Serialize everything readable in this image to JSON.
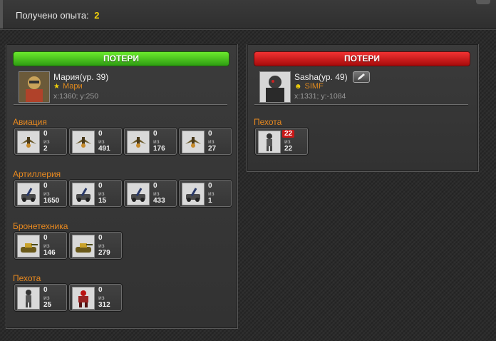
{
  "experience": {
    "label": "Получено опыта:",
    "value": "2"
  },
  "left": {
    "header": "ПОТЕРИ",
    "player": {
      "name": "Мария(ур. 39)",
      "clan": "Мари",
      "coords": "x:1360; y:250"
    },
    "categories": [
      {
        "title": "Авиация",
        "units": [
          {
            "lost": "0",
            "of": "из",
            "total": "2",
            "icon": "aircraft-icon"
          },
          {
            "lost": "0",
            "of": "из",
            "total": "491",
            "icon": "aircraft-icon"
          },
          {
            "lost": "0",
            "of": "из",
            "total": "176",
            "icon": "aircraft-icon"
          },
          {
            "lost": "0",
            "of": "из",
            "total": "27",
            "icon": "aircraft-icon"
          }
        ]
      },
      {
        "title": "Артиллерия",
        "units": [
          {
            "lost": "0",
            "of": "из",
            "total": "1650",
            "icon": "artillery-icon"
          },
          {
            "lost": "0",
            "of": "из",
            "total": "15",
            "icon": "artillery-icon"
          },
          {
            "lost": "0",
            "of": "из",
            "total": "433",
            "icon": "artillery-icon"
          },
          {
            "lost": "0",
            "of": "из",
            "total": "1",
            "icon": "artillery-icon"
          }
        ]
      },
      {
        "title": "Бронетехника",
        "units": [
          {
            "lost": "0",
            "of": "из",
            "total": "146",
            "icon": "tank-icon"
          },
          {
            "lost": "0",
            "of": "из",
            "total": "279",
            "icon": "tank-icon"
          }
        ]
      },
      {
        "title": "Пехота",
        "units": [
          {
            "lost": "0",
            "of": "из",
            "total": "25",
            "icon": "soldier-icon"
          },
          {
            "lost": "0",
            "of": "из",
            "total": "312",
            "icon": "mech-icon"
          }
        ]
      }
    ]
  },
  "right": {
    "header": "ПОТЕРИ",
    "player": {
      "name": "Sasha(ур. 49)",
      "clan": "SIMF",
      "coords": "x:1331; y:-1084"
    },
    "categories": [
      {
        "title": "Пехота",
        "units": [
          {
            "lost": "22",
            "of": "из",
            "total": "22",
            "icon": "soldier-icon"
          }
        ]
      }
    ]
  },
  "colors": {
    "green_header": "#3fb81a",
    "red_header": "#d41a1a",
    "category": "#e8891f",
    "exp_value": "#f2d10a"
  }
}
